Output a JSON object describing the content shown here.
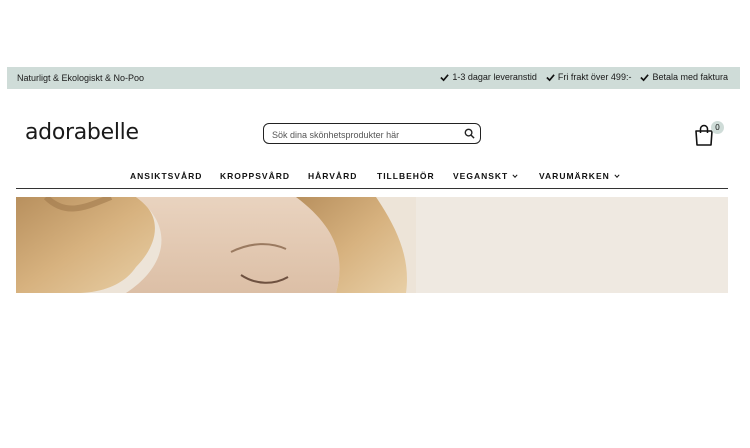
{
  "topbar": {
    "tagline": "Naturligt & Ekologiskt & No-Poo",
    "usps": [
      "1-3 dagar leveranstid",
      "Fri frakt över 499:-",
      "Betala med faktura"
    ],
    "background": "#cfdcd8"
  },
  "header": {
    "logo": "adorabelle",
    "search_placeholder": "Sök dina skönhetsprodukter här",
    "cart_count": "0"
  },
  "nav": {
    "items": [
      {
        "label": "ANSIKTSVÅRD"
      },
      {
        "label": "KROPPSVÅRD"
      },
      {
        "label": "HÅRVÅRD"
      },
      {
        "label": "TILLBEHÖR"
      },
      {
        "label": "VEGANSKT"
      },
      {
        "label": "VARUMÄRKEN"
      }
    ]
  },
  "icons": {
    "check": "check-icon",
    "search": "search-icon",
    "cart": "shopping-bag-icon",
    "chevron": "chevron-down-icon"
  }
}
